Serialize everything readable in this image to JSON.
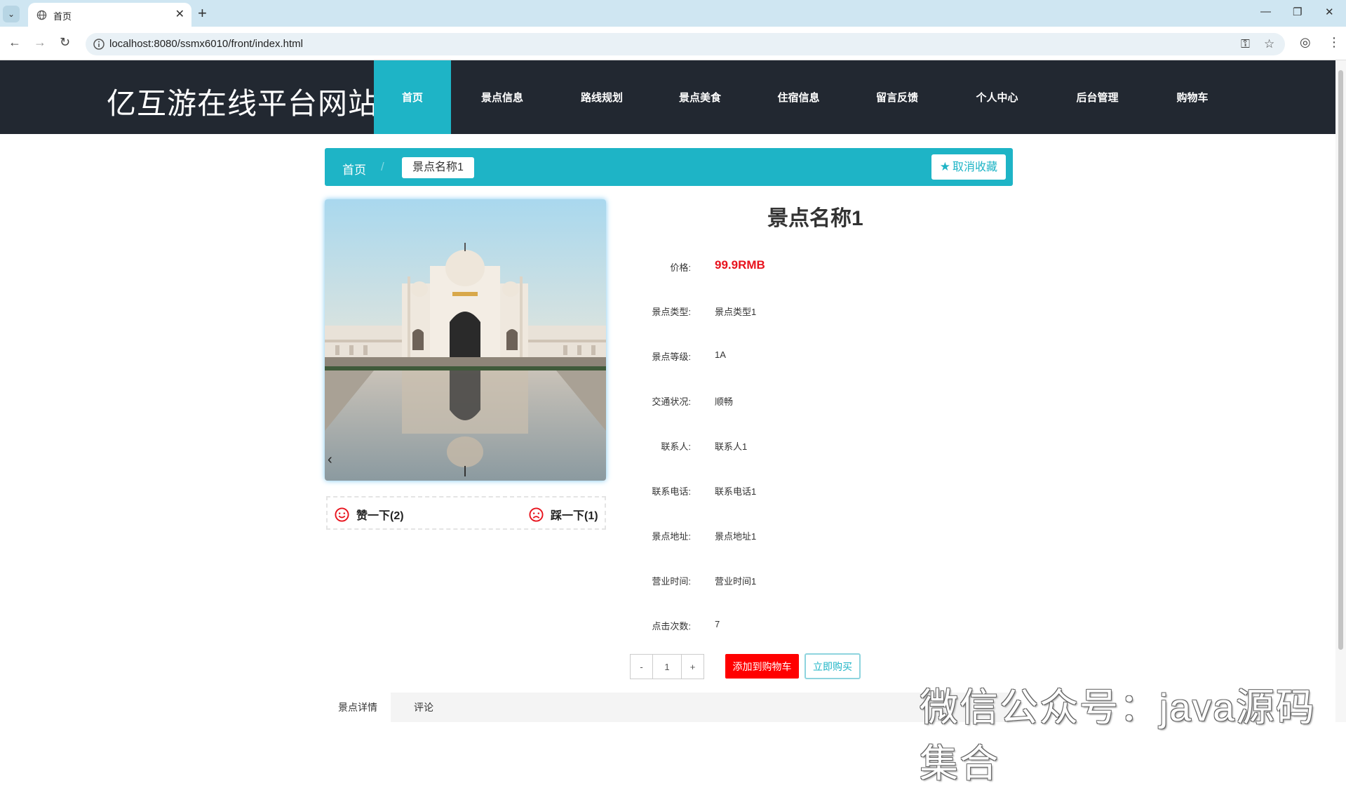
{
  "browser": {
    "tab_title": "首页",
    "url": "localhost:8080/ssmx6010/front/index.html"
  },
  "site": {
    "brand": "亿互游在线平台网站",
    "nav": [
      "首页",
      "景点信息",
      "路线规划",
      "景点美食",
      "住宿信息",
      "留言反馈",
      "个人中心",
      "后台管理",
      "购物车"
    ],
    "active_nav_index": 0,
    "accent_color": "#1eb4c6",
    "header_color": "#222831"
  },
  "breadcrumb": {
    "home": "首页",
    "separator": "/",
    "current": "景点名称1"
  },
  "favorite_button": "取消收藏",
  "votes": {
    "like": "赞一下(2)",
    "dislike": "踩一下(1)"
  },
  "detail": {
    "title": "景点名称1",
    "price_label": "价格:",
    "price": "99.9RMB",
    "rows": [
      {
        "label": "景点类型:",
        "value": "景点类型1"
      },
      {
        "label": "景点等级:",
        "value": "1A"
      },
      {
        "label": "交通状况:",
        "value": "顺畅"
      },
      {
        "label": "联系人:",
        "value": "联系人1"
      },
      {
        "label": "联系电话:",
        "value": "联系电话1"
      },
      {
        "label": "景点地址:",
        "value": "景点地址1"
      },
      {
        "label": "营业时间:",
        "value": "营业时间1"
      },
      {
        "label": "点击次数:",
        "value": "7"
      }
    ]
  },
  "purchase": {
    "minus": "-",
    "quantity": "1",
    "plus": "+",
    "add_to_cart": "添加到购物车",
    "buy_now": "立即购买"
  },
  "tabs": [
    "景点详情",
    "评论"
  ],
  "watermark": "微信公众号：java源码集合"
}
